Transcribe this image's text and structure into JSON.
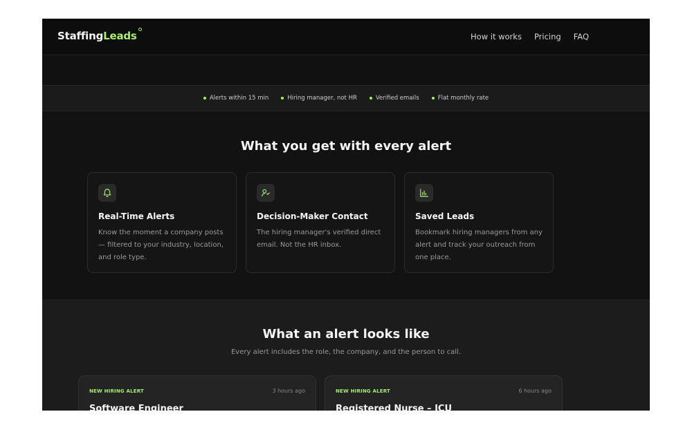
{
  "nav": {
    "logo_part1": "Staffing",
    "logo_part2": "Leads",
    "links": [
      "How it works",
      "Pricing",
      "FAQ"
    ]
  },
  "features": [
    "Alerts within 15 min",
    "Hiring manager, not HR",
    "Verified emails",
    "Flat monthly rate"
  ],
  "section1": {
    "title": "What you get with every alert",
    "cards": [
      {
        "icon": "bell-icon",
        "title": "Real-Time Alerts",
        "description": "Know the moment a company posts — filtered to your industry, location, and role type."
      },
      {
        "icon": "user-check-icon",
        "title": "Decision-Maker Contact",
        "description": "The hiring manager's verified direct email. Not the HR inbox."
      },
      {
        "icon": "bar-chart-icon",
        "title": "Saved Leads",
        "description": "Bookmark hiring managers from any alert and track your outreach from one place."
      }
    ]
  },
  "section2": {
    "title": "What an alert looks like",
    "subtitle": "Every alert includes the role, the company, and the person to call.",
    "alerts": [
      {
        "badge": "NEW HIRING ALERT",
        "time": "3 hours ago",
        "role": "Software Engineer"
      },
      {
        "badge": "NEW HIRING ALERT",
        "time": "6 hours ago",
        "role": "Registered Nurse – ICU"
      }
    ]
  },
  "colors": {
    "accent": "#a6f06a",
    "background": "#141414",
    "card_border": "#2c2c2c"
  }
}
